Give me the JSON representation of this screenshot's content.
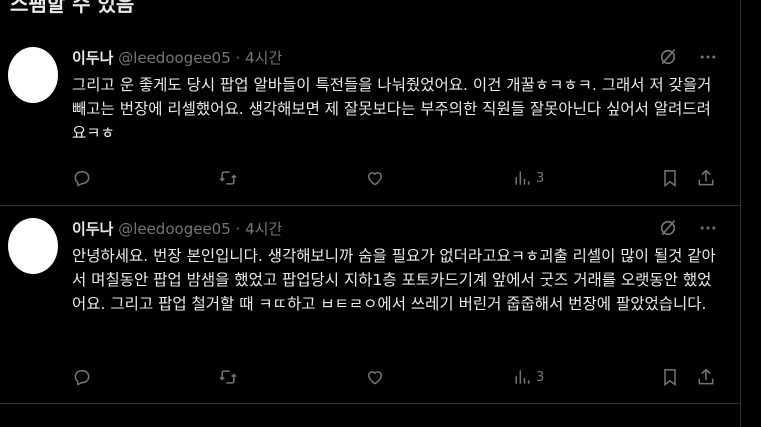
{
  "top_heading": "스팸할 수 있음",
  "tweets": [
    {
      "name": "이두나",
      "handle": "@leedoogee05",
      "dot": "·",
      "time": "4시간",
      "text": "그리고 운 좋게도 당시 팝업 알바들이 특전들을 나눠줬었어요. 이건 개꿀ㅎㅋㅎㅋ. 그래서 저 갖을거 빼고는 번장에 리셀했어요. 생각해보면 제 잘못보다는 부주의한 직원들 잘못아닌다 싶어서 알려드려요ㅋㅎ",
      "views": "3"
    },
    {
      "name": "이두나",
      "handle": "@leedoogee05",
      "dot": "·",
      "time": "4시간",
      "text": "안녕하세요. 번장 본인입니다. 생각해보니까 숨을 필요가 없더라고요ㅋㅎ괴출 리셀이 많이 될것 같아서 며칠동안 팝업 밤샘을 했었고 팝업당시 지하1층 포토카드기계 앞에서 굿즈 거래를 오랫동안 했었어요. 그리고 팝업 철거할 때 ㅋㄸ하고 ㅂㅌㄹㅇ에서 쓰레기 버린거 줍줍해서 번장에 팔았었습니다.",
      "views": "3"
    }
  ],
  "icons": {
    "grok": "grok-slash-icon",
    "more": "more-icon",
    "reply": "reply-icon",
    "retweet": "retweet-icon",
    "like": "like-icon",
    "views": "views-icon",
    "bookmark": "bookmark-icon",
    "share": "share-icon"
  }
}
